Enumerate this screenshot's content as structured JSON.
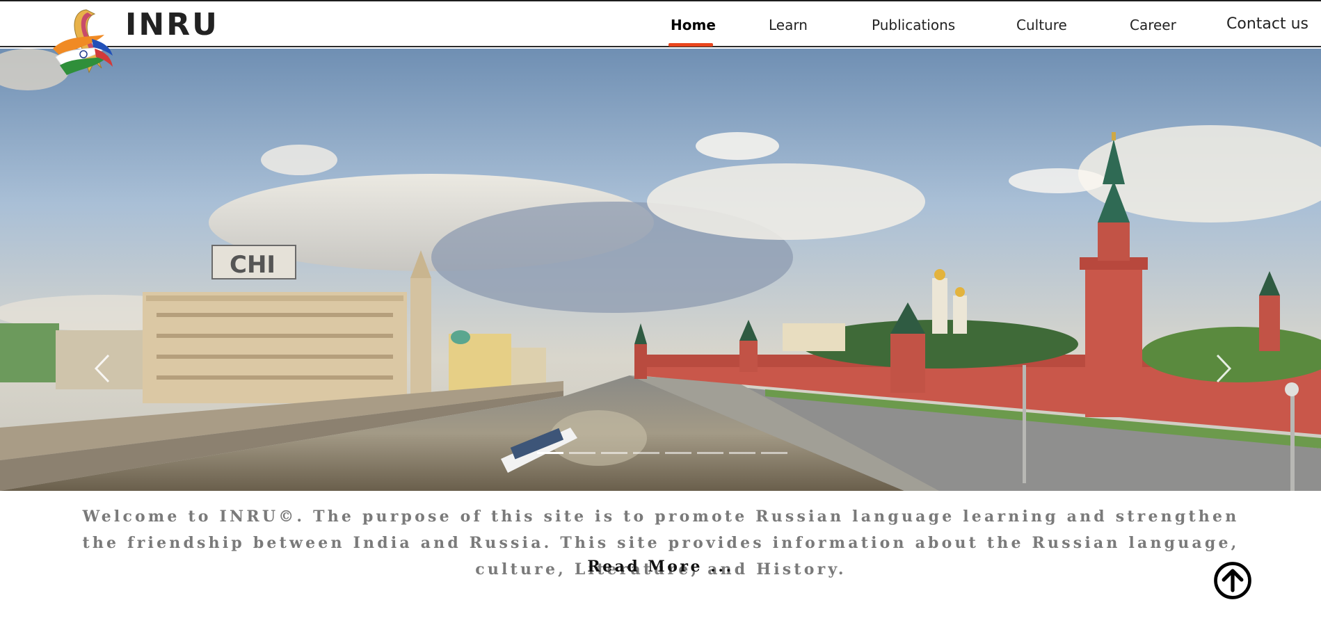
{
  "brand": {
    "name": "INRU"
  },
  "nav": {
    "items": [
      {
        "label": "Home",
        "active": true
      },
      {
        "label": "Learn"
      },
      {
        "label": "Publications"
      },
      {
        "label": "Culture"
      },
      {
        "label": "Career"
      },
      {
        "label": "Contact us"
      }
    ]
  },
  "hero": {
    "slide_count": 8,
    "active_slide": 1
  },
  "intro": {
    "text": "Welcome to INRU©. The purpose of this site is to promote Russian language learning and strengthen the friendship between India and Russia. This site provides information about the Russian language, culture, Literature, and History.",
    "read_more": "Read More ..."
  },
  "colors": {
    "accent": "#e8461e",
    "text_muted": "#7a7a7a"
  },
  "icons": {
    "prev": "chevron-left-icon",
    "next": "chevron-right-icon",
    "to_top": "arrow-up-circle-icon"
  }
}
